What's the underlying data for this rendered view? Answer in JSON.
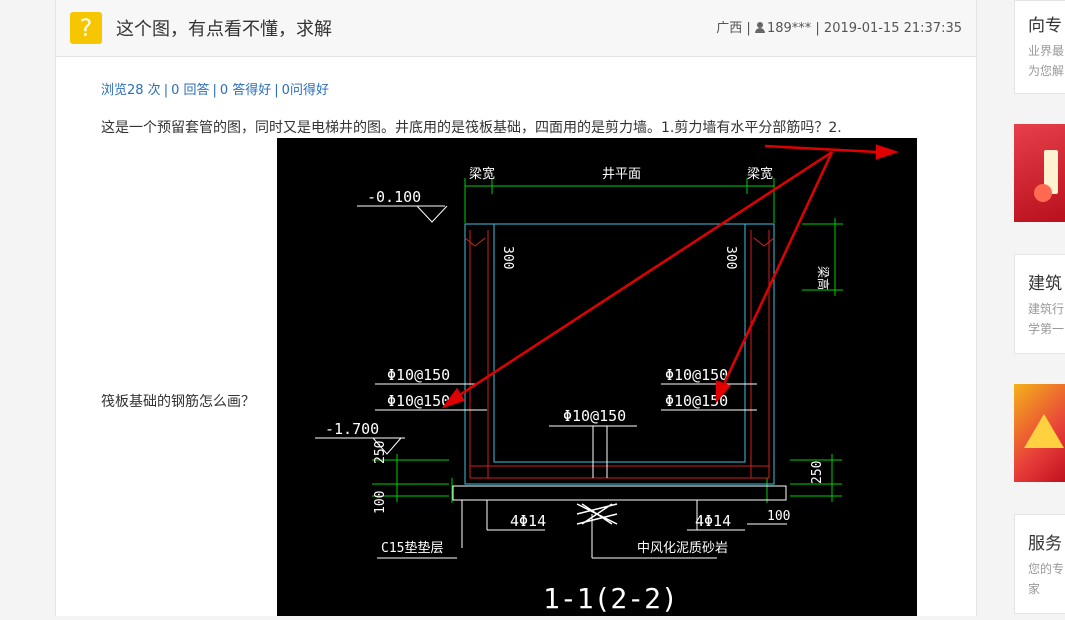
{
  "question": {
    "title": "这个图，有点看不懂，求解",
    "region": "广西",
    "user": "189***",
    "datetime": "2019-01-15 21:37:35",
    "stats": {
      "views": "浏览28 次",
      "answers": "0 回答",
      "good_answers": "0 答得好",
      "good_questions": "0问得好"
    },
    "body_line1": "这是一个预留套管的图，同时又是电梯井的图。井底用的是筏板基础，四面用的是剪力墙。1.剪力墙有水平分部筋吗？2.",
    "body_line2": "筏板基础的钢筋怎么画？"
  },
  "drawing": {
    "labels": {
      "elev_top": "-0.100",
      "elev_bottom": "-1.700",
      "beam_width_left": "梁宽",
      "beam_width_right": "梁宽",
      "shaft_plane": "井平面",
      "beam_height": "梁高",
      "dim_300_left": "300",
      "dim_300_right": "300",
      "rebar_l1": "Φ10@150",
      "rebar_l2": "Φ10@150",
      "rebar_r1": "Φ10@150",
      "rebar_r2": "Φ10@150",
      "rebar_mid": "Φ10@150",
      "dim_250_left": "250",
      "dim_100_left": "100",
      "dim_250_right": "250",
      "dim_100_right": "100",
      "bar_left": "4Φ14",
      "bar_right": "4Φ14",
      "cushion": "C15垫垫层",
      "sandstone": "中风化泥质砂岩",
      "section_title": "1-1(2-2)"
    },
    "colors": {
      "background": "#000000",
      "dimension": "#00d000",
      "text": "#ffffff",
      "wall": "#d02020",
      "inner": "#40c0e0",
      "arrow": "#e00000"
    }
  },
  "sidebar": {
    "cards": [
      {
        "title": "向专",
        "desc1": "业界最",
        "desc2": "为您解"
      },
      {
        "title": "建筑",
        "desc1": "建筑行",
        "desc2": "学第一"
      },
      {
        "title": "服务",
        "desc1": "您的专",
        "desc2": "家"
      }
    ]
  }
}
